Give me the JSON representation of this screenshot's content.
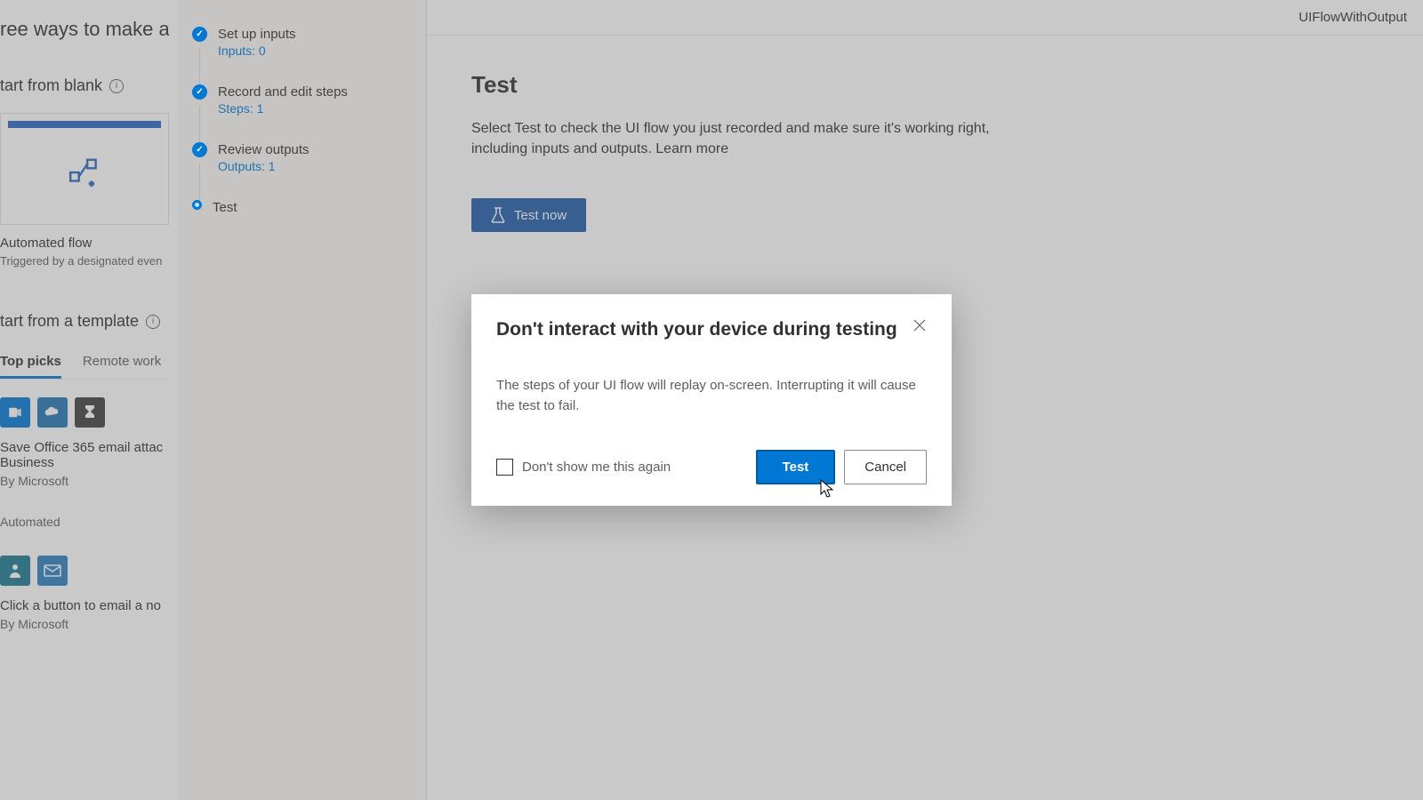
{
  "header": {
    "flow_name": "UIFlowWithOutput"
  },
  "left": {
    "top_heading": "ree ways to make a flo",
    "start_blank": "tart from blank",
    "auto_flow_title": "Automated flow",
    "auto_flow_sub": "Triggered by a designated even",
    "start_template": "tart from a template",
    "tabs": {
      "top_picks": "Top picks",
      "remote_work": "Remote work"
    },
    "tpl1_title": "Save Office 365 email attac",
    "tpl1_title2": "Business",
    "tpl1_by": "By Microsoft",
    "tpl1_meta": "Automated",
    "tpl2_title": "Click a button to email a no",
    "tpl2_by": "By Microsoft"
  },
  "steps": [
    {
      "label": "Set up inputs",
      "meta": "Inputs: 0",
      "state": "done"
    },
    {
      "label": "Record and edit steps",
      "meta": "Steps: 1",
      "state": "done"
    },
    {
      "label": "Review outputs",
      "meta": "Outputs: 1",
      "state": "done"
    },
    {
      "label": "Test",
      "meta": "",
      "state": "current"
    }
  ],
  "main": {
    "title": "Test",
    "desc": "Select Test to check the UI flow you just recorded and make sure it's working right, including inputs and outputs. ",
    "learn_more": "Learn more",
    "test_now": "Test now"
  },
  "dialog": {
    "title": "Don't interact with your device during testing",
    "body": "The steps of your UI flow will replay on-screen. Interrupting it will cause the test to fail.",
    "checkbox_label": "Don't show me this again",
    "test": "Test",
    "cancel": "Cancel"
  }
}
